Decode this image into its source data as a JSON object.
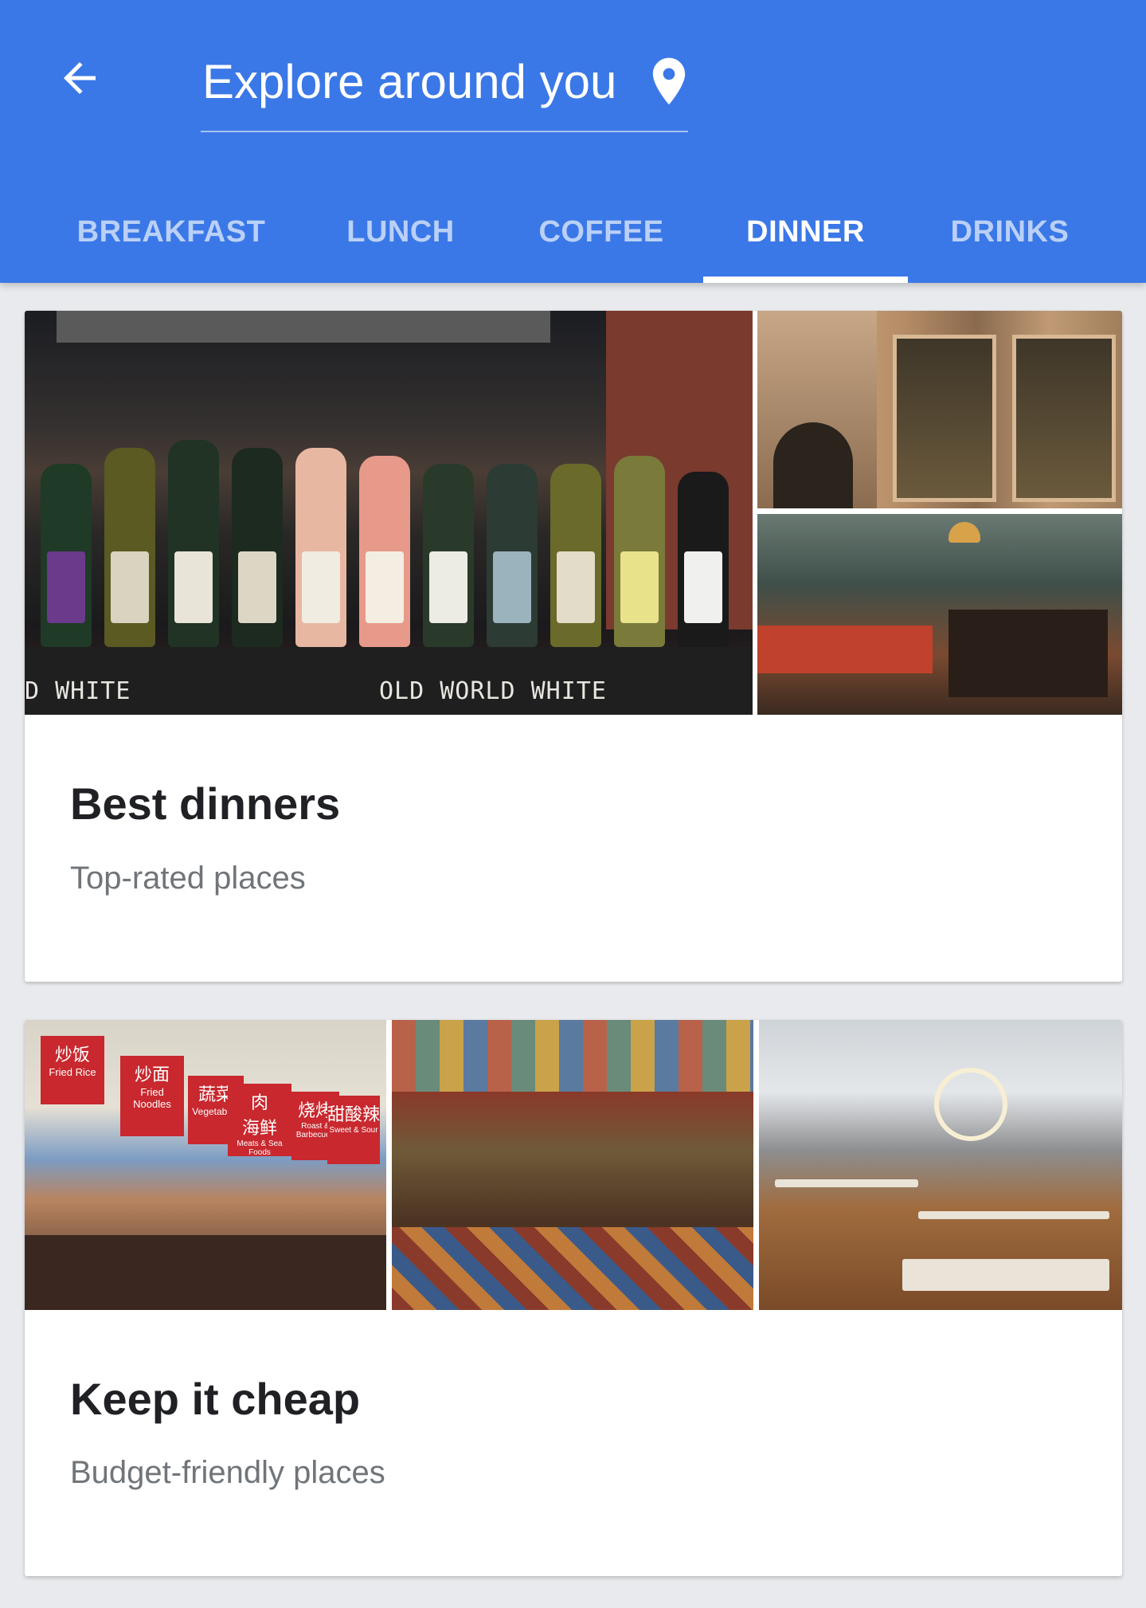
{
  "header": {
    "title": "Explore around you",
    "back_icon": "arrow-back-icon",
    "location_icon": "location-pin-icon",
    "background_color": "#3b78e7"
  },
  "tabs": [
    {
      "label": "BREAKFAST",
      "active": false
    },
    {
      "label": "LUNCH",
      "active": false
    },
    {
      "label": "COFFEE",
      "active": false
    },
    {
      "label": "DINNER",
      "active": true
    },
    {
      "label": "DRINKS",
      "active": false
    }
  ],
  "cards": [
    {
      "title": "Best dinners",
      "subtitle": "Top-rated places",
      "photo_texts": [
        "OLD WORLD WHITE",
        "D WHITE"
      ]
    },
    {
      "title": "Keep it cheap",
      "subtitle": "Budget-friendly places",
      "photo_texts": [
        "炒饭",
        "Fried Rice",
        "炒面",
        "Fried Noodles",
        "蔬菜",
        "Vegetables",
        "肉",
        "海鲜",
        "Meats & Sea Foods",
        "烧烤",
        "Roast & Barbecued",
        "甜酸辣",
        "Sweet & Sour"
      ]
    }
  ]
}
